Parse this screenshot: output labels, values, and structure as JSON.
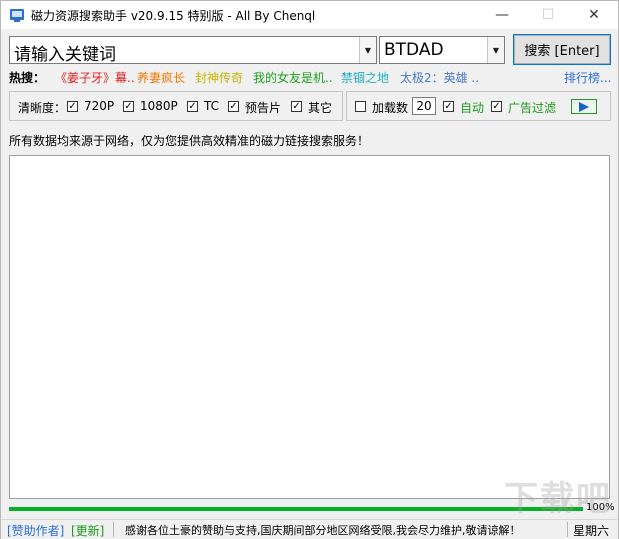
{
  "window": {
    "title": "磁力资源搜索助手 v20.9.15 特别版 - All By Chenql",
    "minimize_glyph": "—",
    "maximize_glyph": "☐",
    "close_glyph": "✕"
  },
  "search": {
    "keyword_value": "请输入关键词",
    "engine_value": "BTDAD",
    "search_button": "搜索 [Enter]"
  },
  "hot": {
    "label": "热搜：",
    "items": [
      {
        "text": "《姜子牙》幕..",
        "color": "#e02020"
      },
      {
        "text": "养妻疯长",
        "color": "#f07800"
      },
      {
        "text": "封神传奇",
        "color": "#c8b400"
      },
      {
        "text": "我的女友是机..",
        "color": "#22a020"
      },
      {
        "text": "禁锢之地",
        "color": "#20b0c0"
      },
      {
        "text": "太极2：英雄 ..",
        "color": "#4a78c8"
      }
    ],
    "ranking_link": "排行榜..."
  },
  "filters": {
    "clarity_label": "清晰度：",
    "options": [
      "720P",
      "1080P",
      "TC",
      "预告片",
      "其它"
    ],
    "load_count_label": "加载数",
    "load_count_value": "20",
    "auto_label": "自动",
    "ad_filter_label": "广告过滤"
  },
  "info": {
    "notice": "所有数据均来源于网络，仅为您提供高效精准的磁力链接搜索服务！"
  },
  "progress": {
    "percent_label": "100%",
    "percent": 100
  },
  "status": {
    "sponsor_link": "[赞助作者]",
    "update_link": "[更新]",
    "message": "感谢各位土豪的赞助与支持,国庆期间部分地区网络受限,我会尽力维护,敬请谅解！",
    "weekday": "星期六"
  },
  "watermark": "下载吧",
  "colors": {
    "accent": "#0078d7",
    "green": "#06b025",
    "link_blue": "#2a6fd0",
    "link_green": "#1c9a1c"
  }
}
